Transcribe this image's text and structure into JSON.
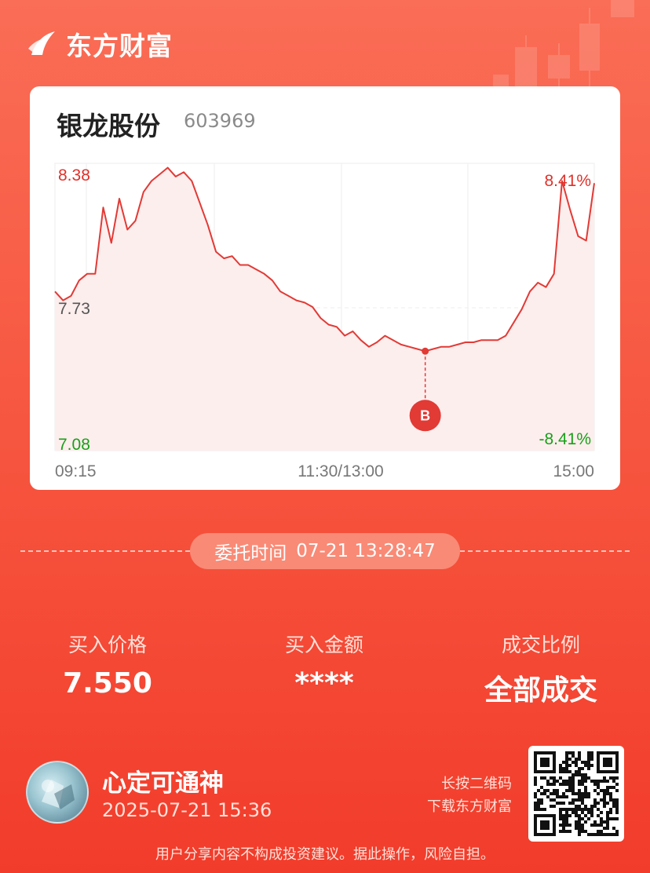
{
  "brand": {
    "name": "东方财富",
    "logo_icon": "eastmoney-logo-icon"
  },
  "stock": {
    "name": "银龙股份",
    "code": "603969"
  },
  "chart": {
    "price_high": "8.38",
    "price_mid": "7.73",
    "price_low": "7.08",
    "pct_high": "8.41%",
    "pct_low": "-8.41%",
    "time_start": "09:15",
    "time_mid": "11:30/13:00",
    "time_end": "15:00",
    "buy_marker": "B",
    "colors": {
      "up": "#e0312a",
      "down": "#19a019",
      "line": "#e23a35",
      "fill": "#fdeeee"
    }
  },
  "chart_data": {
    "type": "line",
    "title": "",
    "xlabel": "",
    "ylabel": "",
    "ylim": [
      7.08,
      8.38
    ],
    "x_ticks": [
      "09:15",
      "11:30/13:00",
      "15:00"
    ],
    "y_ticks": [
      "7.08",
      "7.73",
      "8.38"
    ],
    "right_ticks": [
      "-8.41%",
      "8.41%"
    ],
    "grid": true,
    "series": [
      {
        "values": [
          7.8,
          7.76,
          7.78,
          7.85,
          7.88,
          7.88,
          8.18,
          8.02,
          8.22,
          8.08,
          8.12,
          8.25,
          8.3,
          8.33,
          8.36,
          8.32,
          8.34,
          8.3,
          8.2,
          8.1,
          7.98,
          7.95,
          7.96,
          7.92,
          7.92,
          7.9,
          7.88,
          7.85,
          7.8,
          7.78,
          7.76,
          7.75,
          7.73,
          7.68,
          7.65,
          7.64,
          7.6,
          7.62,
          7.58,
          7.55,
          7.57,
          7.6,
          7.58,
          7.56,
          7.55,
          7.54,
          7.53,
          7.54,
          7.55,
          7.55,
          7.56,
          7.57,
          7.57,
          7.58,
          7.58,
          7.58,
          7.6,
          7.66,
          7.72,
          7.8,
          7.84,
          7.82,
          7.88,
          8.3,
          8.17,
          8.05,
          8.03,
          8.29
        ]
      }
    ],
    "buy_point": {
      "price": 7.53,
      "label": "B"
    }
  },
  "order": {
    "time_label": "委托时间",
    "time_value": "07-21 13:28:47"
  },
  "stats": [
    {
      "label": "买入价格",
      "value": "7.550"
    },
    {
      "label": "买入金额",
      "value": "****"
    },
    {
      "label": "成交比例",
      "value": "全部成交"
    }
  ],
  "user": {
    "name": "心定可通神",
    "datetime": "2025-07-21 15:36",
    "avatar_icon": "avatar-image"
  },
  "qr": {
    "hint_line1": "长按二维码",
    "hint_line2": "下载东方财富",
    "icon": "qr-code"
  },
  "disclaimer": "用户分享内容不构成投资建议。据此操作，风险自担。"
}
